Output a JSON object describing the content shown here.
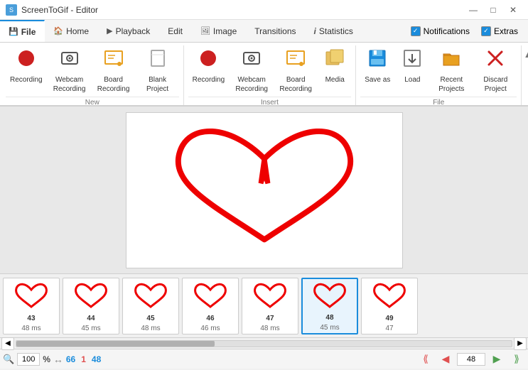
{
  "titlebar": {
    "app_name": "ScreenToGif - Editor",
    "min_btn": "—",
    "max_btn": "□",
    "close_btn": "✕"
  },
  "tabs": [
    {
      "id": "file",
      "label": "File",
      "icon": "💾",
      "active": true
    },
    {
      "id": "home",
      "label": "Home",
      "icon": "🏠",
      "active": false
    },
    {
      "id": "playback",
      "label": "Playback",
      "icon": "▶",
      "active": false
    },
    {
      "id": "edit",
      "label": "Edit",
      "icon": "✏️",
      "active": false
    },
    {
      "id": "image",
      "label": "Image",
      "icon": "🖼️",
      "active": false
    },
    {
      "id": "transitions",
      "label": "Transitions",
      "icon": "⟷",
      "active": false
    },
    {
      "id": "statistics",
      "label": "Statistics",
      "icon": "i",
      "active": false
    }
  ],
  "toggles": [
    {
      "id": "notifications",
      "label": "Notifications",
      "checked": true
    },
    {
      "id": "extras",
      "label": "Extras",
      "checked": true
    }
  ],
  "ribbon": {
    "groups": [
      {
        "id": "new",
        "label": "New",
        "buttons": [
          {
            "id": "recording",
            "label": "Recording",
            "icon": "recording"
          },
          {
            "id": "webcam-recording",
            "label": "Webcam Recording",
            "icon": "camera"
          },
          {
            "id": "board-recording",
            "label": "Board Recording",
            "icon": "board"
          },
          {
            "id": "blank-project",
            "label": "Blank Project",
            "icon": "blank"
          }
        ]
      },
      {
        "id": "insert",
        "label": "Insert",
        "buttons": [
          {
            "id": "recording2",
            "label": "Recording",
            "icon": "recording"
          },
          {
            "id": "webcam-recording2",
            "label": "Webcam Recording",
            "icon": "camera"
          },
          {
            "id": "board-recording2",
            "label": "Board Recording",
            "icon": "board"
          },
          {
            "id": "media",
            "label": "Media",
            "icon": "media"
          }
        ]
      },
      {
        "id": "file",
        "label": "File",
        "buttons": [
          {
            "id": "save-as",
            "label": "Save as",
            "icon": "save"
          },
          {
            "id": "load",
            "label": "Load",
            "icon": "load"
          },
          {
            "id": "recent-projects",
            "label": "Recent Projects",
            "icon": "folder"
          },
          {
            "id": "discard-project",
            "label": "Discard Project",
            "icon": "discard"
          }
        ]
      }
    ]
  },
  "filmstrip": {
    "frames": [
      {
        "num": "43",
        "ms": "48 ms"
      },
      {
        "num": "44",
        "ms": "45 ms"
      },
      {
        "num": "45",
        "ms": "48 ms"
      },
      {
        "num": "46",
        "ms": "46 ms"
      },
      {
        "num": "47",
        "ms": "48 ms"
      },
      {
        "num": "48",
        "ms": "45 ms",
        "selected": true
      },
      {
        "num": "49",
        "ms": "47"
      }
    ]
  },
  "bottombar": {
    "zoom_value": "100",
    "zoom_symbol": "%",
    "count1": "66",
    "count2": "1",
    "count3": "48"
  }
}
